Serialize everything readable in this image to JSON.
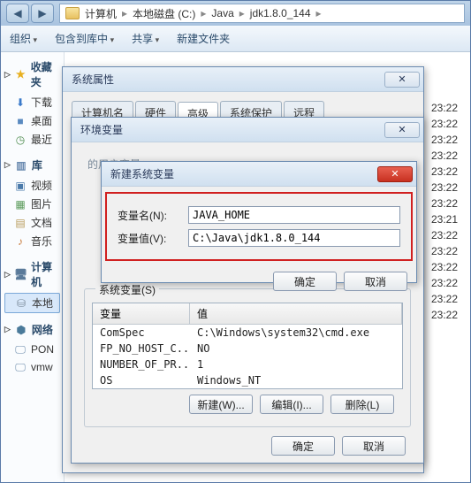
{
  "breadcrumb": {
    "p1": "计算机",
    "p2": "本地磁盘 (C:)",
    "p3": "Java",
    "p4": "jdk1.8.0_144"
  },
  "toolbar": {
    "org": "组织",
    "incl": "包含到库中",
    "share": "共享",
    "newf": "新建文件夹"
  },
  "sidebar": {
    "fav": "收藏夹",
    "dl": "下载",
    "desk": "桌面",
    "recent": "最近",
    "lib": "库",
    "vid": "视频",
    "pic": "图片",
    "doc": "文档",
    "mus": "音乐",
    "comp": "计算机",
    "disk": "本地",
    "net": "网络",
    "pon": "PON",
    "vmw": "vmw"
  },
  "times": [
    "23:22",
    "23:22",
    "23:22",
    "23:22",
    "23:22",
    "23:22",
    "23:22",
    "23:21",
    "23:22",
    "23:22",
    "23:22",
    "23:22",
    "23:22",
    "23:22"
  ],
  "sysprops": {
    "title": "系统属性",
    "tabs": {
      "t1": "计算机名",
      "t2": "硬件",
      "t3": "高级",
      "t4": "系统保护",
      "t5": "远程"
    }
  },
  "envdlg": {
    "title": "环境变量",
    "userhint": "的用户变量(U)",
    "sysgroup": "系统变量(S)",
    "cols": {
      "name": "变量",
      "val": "值"
    },
    "rows": [
      {
        "n": "ComSpec",
        "v": "C:\\Windows\\system32\\cmd.exe"
      },
      {
        "n": "FP_NO_HOST_C...",
        "v": "NO"
      },
      {
        "n": "NUMBER_OF_PR...",
        "v": "1"
      },
      {
        "n": "OS",
        "v": "Windows_NT"
      }
    ],
    "btns": {
      "new": "新建(W)...",
      "edit": "编辑(I)...",
      "del": "删除(L)"
    },
    "ok": "确定",
    "cancel": "取消"
  },
  "newvar": {
    "title": "新建系统变量",
    "name_lbl": "变量名(N):",
    "name_val": "JAVA_HOME",
    "val_lbl": "变量值(V):",
    "val_val": "C:\\Java\\jdk1.8.0_144",
    "ok": "确定",
    "cancel": "取消"
  }
}
